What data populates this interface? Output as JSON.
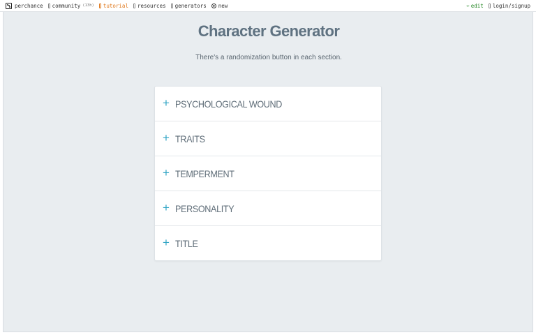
{
  "topbar": {
    "brand": "perchance",
    "community": "community",
    "community_count": "(13h)",
    "tutorial": "tutorial",
    "resources": "resources",
    "generators": "generators",
    "new": "new",
    "edit": "edit",
    "login": "login/signup",
    "colors": {
      "tutorial": "#e07a1f",
      "edit": "#2a8a2a"
    }
  },
  "page": {
    "title": "Character Generator",
    "subtitle": "There's a randomization button in each section."
  },
  "accordion": {
    "expand_icon": "plus-icon",
    "accent_color": "#2fa4c4",
    "items": [
      {
        "label": "PSYCHOLOGICAL WOUND"
      },
      {
        "label": "TRAITS"
      },
      {
        "label": "TEMPERMENT"
      },
      {
        "label": "PERSONALITY"
      },
      {
        "label": "TITLE"
      }
    ]
  }
}
